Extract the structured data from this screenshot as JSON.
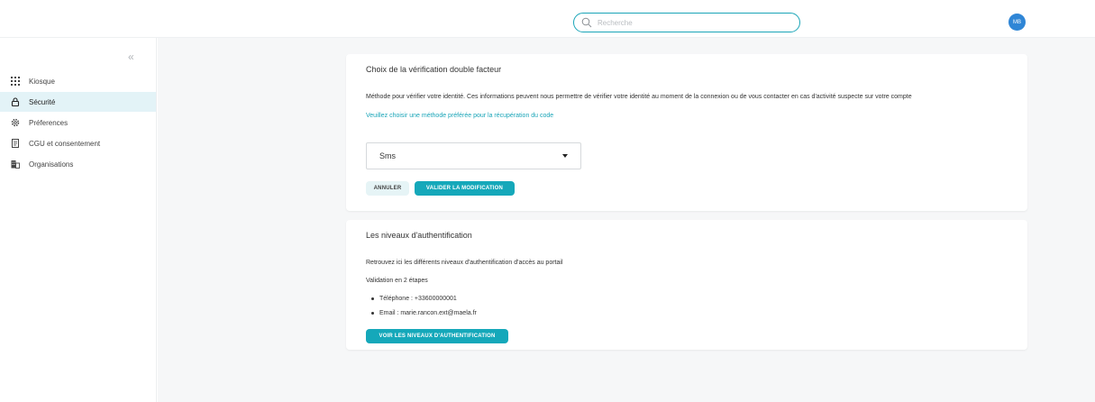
{
  "header": {
    "search_placeholder": "Recherche",
    "avatar_initials": "MB"
  },
  "sidebar": {
    "collapse_label": "«",
    "items": [
      {
        "label": "Kiosque",
        "icon": "grid-icon",
        "active": false
      },
      {
        "label": "Sécurité",
        "icon": "lock-icon",
        "active": true
      },
      {
        "label": "Préferences",
        "icon": "gear-icon",
        "active": false
      },
      {
        "label": "CGU et consentement",
        "icon": "document-icon",
        "active": false
      },
      {
        "label": "Organisations",
        "icon": "building-icon",
        "active": false
      }
    ]
  },
  "mfa_card": {
    "title": "Choix de la vérification double facteur",
    "description": "Méthode pour vérifier votre identité. Ces informations peuvent nous permettre de vérifier votre identité au moment de la connexion ou de vous contacter en cas d'activité suspecte sur votre compte",
    "hint_link": "Veuillez choisir une méthode préférée pour la récupération du code",
    "selected_method": "Sms",
    "cancel_label": "ANNULER",
    "validate_label": "VALIDER LA MODIFICATION"
  },
  "auth_card": {
    "title": "Les niveaux d'authentification",
    "description": "Retrouvez ici les différents niveaux d'authentification d'accès au portail",
    "subheading": "Validation en 2 étapes",
    "phone": "Téléphone : +33600000001",
    "email": "Email : marie.rancon.ext@maela.fr",
    "button_label": "VOIR LES NIVEAUX D'AUTHENTIFICATION"
  },
  "colors": {
    "accent": "#15a8ba",
    "avatar": "#2f86d6",
    "active_nav_bg": "#e3f3f7"
  }
}
